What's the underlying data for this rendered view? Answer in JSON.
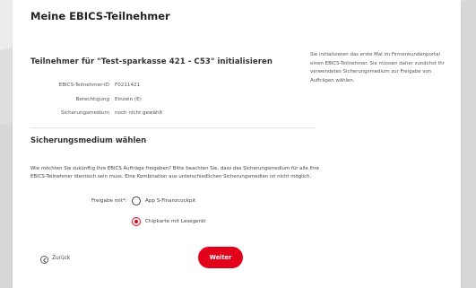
{
  "page": {
    "title": "Meine EBICS-Teilnehmer"
  },
  "section1": {
    "title": "Teilnehmer für \"Test-sparkasse 421 - C53\" initialisieren",
    "fields": [
      {
        "label": "EBICS-Teilnehmer-ID",
        "value": "F0211421"
      },
      {
        "label": "Berechtigung",
        "value": "Einzeln (E)"
      },
      {
        "label": "Sicherungsmedium",
        "value": "noch nicht gewählt"
      }
    ]
  },
  "sidebar": {
    "info": "Sie initialisieren das erste Mal im Firmenkundenportal einen EBICS-Teilnehmer. Sie müssen daher zunächst Ihr verwendetes Sicherungsmedium zur Freigabe von Aufträgen wählen."
  },
  "section2": {
    "title": "Sicherungsmedium wählen",
    "description": "Wie möchten Sie zukünftig Ihre EBICS Aufträge freigeben? Bitte beachten Sie, dass das Sicherungsmedium für alle Ihre EBICS-Teilnehmer identisch sein muss. Eine Kombination aus unterschiedlichen Sicherungsmedien ist nicht möglich.",
    "freigabe_label": "Freigabe mit*:",
    "options": [
      {
        "label": "App S-Finanzcockpit",
        "selected": false
      },
      {
        "label": "Chipkarte mit Lesegerät",
        "selected": true
      }
    ]
  },
  "actions": {
    "back_label": "Zurück",
    "next_label": "Weiter"
  },
  "colors": {
    "accent": "#e2001a"
  }
}
